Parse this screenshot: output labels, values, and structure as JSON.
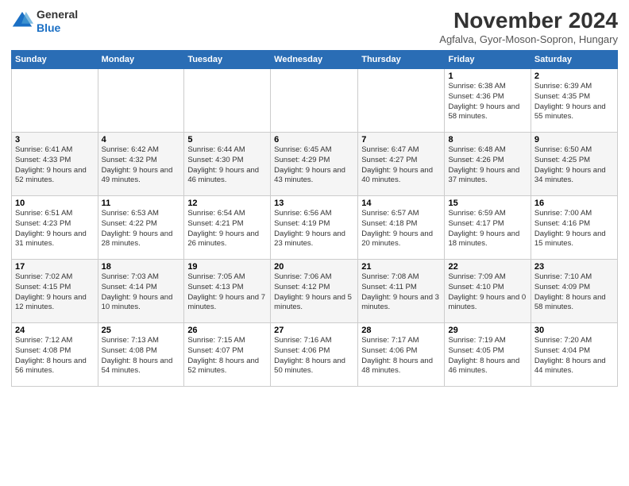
{
  "header": {
    "logo_line1": "General",
    "logo_line2": "Blue",
    "month_title": "November 2024",
    "location": "Agfalva, Gyor-Moson-Sopron, Hungary"
  },
  "days_of_week": [
    "Sunday",
    "Monday",
    "Tuesday",
    "Wednesday",
    "Thursday",
    "Friday",
    "Saturday"
  ],
  "weeks": [
    {
      "days": [
        {
          "num": "",
          "info": ""
        },
        {
          "num": "",
          "info": ""
        },
        {
          "num": "",
          "info": ""
        },
        {
          "num": "",
          "info": ""
        },
        {
          "num": "",
          "info": ""
        },
        {
          "num": "1",
          "info": "Sunrise: 6:38 AM\nSunset: 4:36 PM\nDaylight: 9 hours and 58 minutes."
        },
        {
          "num": "2",
          "info": "Sunrise: 6:39 AM\nSunset: 4:35 PM\nDaylight: 9 hours and 55 minutes."
        }
      ]
    },
    {
      "days": [
        {
          "num": "3",
          "info": "Sunrise: 6:41 AM\nSunset: 4:33 PM\nDaylight: 9 hours and 52 minutes."
        },
        {
          "num": "4",
          "info": "Sunrise: 6:42 AM\nSunset: 4:32 PM\nDaylight: 9 hours and 49 minutes."
        },
        {
          "num": "5",
          "info": "Sunrise: 6:44 AM\nSunset: 4:30 PM\nDaylight: 9 hours and 46 minutes."
        },
        {
          "num": "6",
          "info": "Sunrise: 6:45 AM\nSunset: 4:29 PM\nDaylight: 9 hours and 43 minutes."
        },
        {
          "num": "7",
          "info": "Sunrise: 6:47 AM\nSunset: 4:27 PM\nDaylight: 9 hours and 40 minutes."
        },
        {
          "num": "8",
          "info": "Sunrise: 6:48 AM\nSunset: 4:26 PM\nDaylight: 9 hours and 37 minutes."
        },
        {
          "num": "9",
          "info": "Sunrise: 6:50 AM\nSunset: 4:25 PM\nDaylight: 9 hours and 34 minutes."
        }
      ]
    },
    {
      "days": [
        {
          "num": "10",
          "info": "Sunrise: 6:51 AM\nSunset: 4:23 PM\nDaylight: 9 hours and 31 minutes."
        },
        {
          "num": "11",
          "info": "Sunrise: 6:53 AM\nSunset: 4:22 PM\nDaylight: 9 hours and 28 minutes."
        },
        {
          "num": "12",
          "info": "Sunrise: 6:54 AM\nSunset: 4:21 PM\nDaylight: 9 hours and 26 minutes."
        },
        {
          "num": "13",
          "info": "Sunrise: 6:56 AM\nSunset: 4:19 PM\nDaylight: 9 hours and 23 minutes."
        },
        {
          "num": "14",
          "info": "Sunrise: 6:57 AM\nSunset: 4:18 PM\nDaylight: 9 hours and 20 minutes."
        },
        {
          "num": "15",
          "info": "Sunrise: 6:59 AM\nSunset: 4:17 PM\nDaylight: 9 hours and 18 minutes."
        },
        {
          "num": "16",
          "info": "Sunrise: 7:00 AM\nSunset: 4:16 PM\nDaylight: 9 hours and 15 minutes."
        }
      ]
    },
    {
      "days": [
        {
          "num": "17",
          "info": "Sunrise: 7:02 AM\nSunset: 4:15 PM\nDaylight: 9 hours and 12 minutes."
        },
        {
          "num": "18",
          "info": "Sunrise: 7:03 AM\nSunset: 4:14 PM\nDaylight: 9 hours and 10 minutes."
        },
        {
          "num": "19",
          "info": "Sunrise: 7:05 AM\nSunset: 4:13 PM\nDaylight: 9 hours and 7 minutes."
        },
        {
          "num": "20",
          "info": "Sunrise: 7:06 AM\nSunset: 4:12 PM\nDaylight: 9 hours and 5 minutes."
        },
        {
          "num": "21",
          "info": "Sunrise: 7:08 AM\nSunset: 4:11 PM\nDaylight: 9 hours and 3 minutes."
        },
        {
          "num": "22",
          "info": "Sunrise: 7:09 AM\nSunset: 4:10 PM\nDaylight: 9 hours and 0 minutes."
        },
        {
          "num": "23",
          "info": "Sunrise: 7:10 AM\nSunset: 4:09 PM\nDaylight: 8 hours and 58 minutes."
        }
      ]
    },
    {
      "days": [
        {
          "num": "24",
          "info": "Sunrise: 7:12 AM\nSunset: 4:08 PM\nDaylight: 8 hours and 56 minutes."
        },
        {
          "num": "25",
          "info": "Sunrise: 7:13 AM\nSunset: 4:08 PM\nDaylight: 8 hours and 54 minutes."
        },
        {
          "num": "26",
          "info": "Sunrise: 7:15 AM\nSunset: 4:07 PM\nDaylight: 8 hours and 52 minutes."
        },
        {
          "num": "27",
          "info": "Sunrise: 7:16 AM\nSunset: 4:06 PM\nDaylight: 8 hours and 50 minutes."
        },
        {
          "num": "28",
          "info": "Sunrise: 7:17 AM\nSunset: 4:06 PM\nDaylight: 8 hours and 48 minutes."
        },
        {
          "num": "29",
          "info": "Sunrise: 7:19 AM\nSunset: 4:05 PM\nDaylight: 8 hours and 46 minutes."
        },
        {
          "num": "30",
          "info": "Sunrise: 7:20 AM\nSunset: 4:04 PM\nDaylight: 8 hours and 44 minutes."
        }
      ]
    }
  ]
}
